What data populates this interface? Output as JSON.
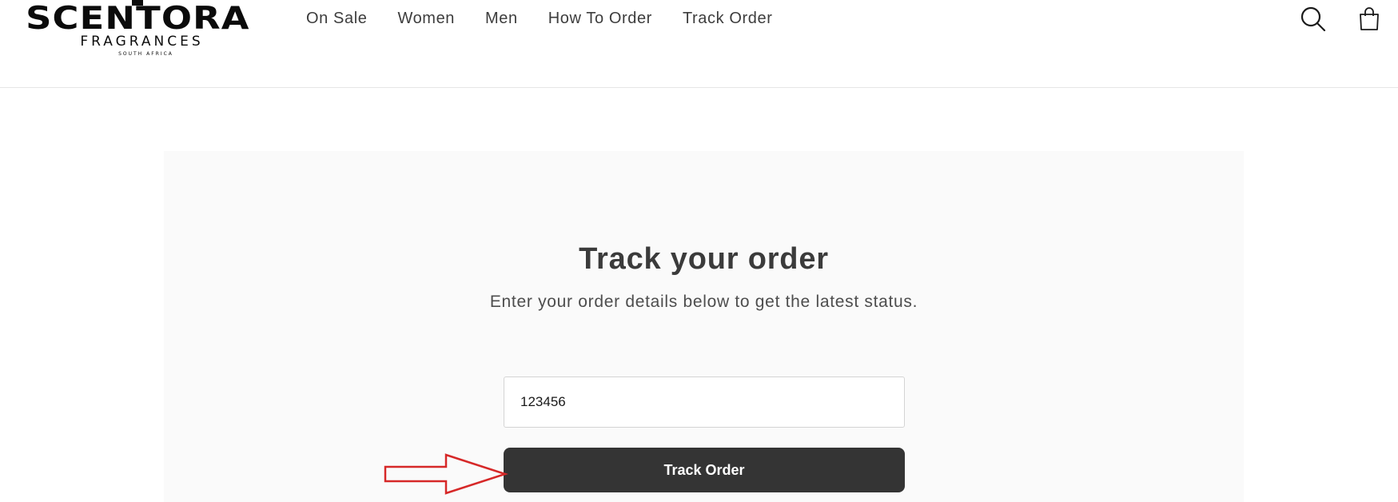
{
  "header": {
    "logo": {
      "brand": "SCENTORA",
      "subtitle": "FRAGRANCES",
      "tagline": "SOUTH AFRICA"
    },
    "nav": [
      {
        "label": "On Sale"
      },
      {
        "label": "Women"
      },
      {
        "label": "Men"
      },
      {
        "label": "How To Order"
      },
      {
        "label": "Track Order"
      }
    ],
    "icons": {
      "search": "search-icon",
      "cart": "cart-icon"
    }
  },
  "main": {
    "title": "Track your order",
    "description": "Enter your order details below to get the latest status.",
    "order_input": {
      "value": "123456"
    },
    "submit_label": "Track Order"
  },
  "annotation": {
    "arrow_color": "#d62828"
  }
}
